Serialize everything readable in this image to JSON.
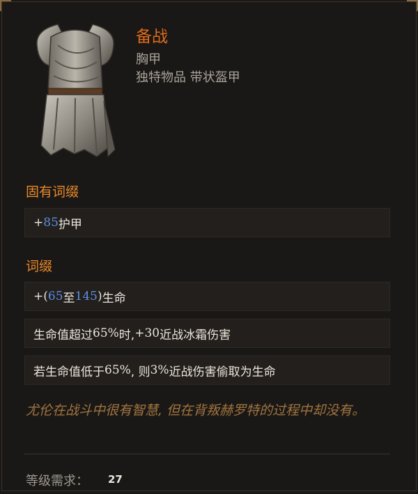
{
  "item": {
    "name": "备战",
    "slot": "胸甲",
    "type": "独特物品 带状盔甲",
    "image_icon": "chest-armor-icon"
  },
  "implicit": {
    "title": "固有词缀",
    "lines": [
      {
        "prefix": "+",
        "num1": "85",
        "text": " 护甲"
      }
    ]
  },
  "affixes": {
    "title": "词缀",
    "lines": [
      {
        "prefix": "+(",
        "num1": "65",
        "mid": " 至 ",
        "num2": "145",
        "suffix": ")",
        "text": " 生命"
      },
      {
        "text_a": "生命值超过 ",
        "value_a": "65%",
        "text_b": " 时, ",
        "value_b": "+30",
        "text_c": " 近战冰霜伤害"
      },
      {
        "text_a": "若生命值低于 ",
        "value_a": "65%",
        "text_b": ", 则 ",
        "value_b": "3%",
        "text_c": " 近战伤害偷取为生命"
      }
    ]
  },
  "flavor": "尤伦在战斗中很有智慧, 但在背叛赫罗特的过程中却没有。",
  "requirement": {
    "label": "等级需求：",
    "value": "27"
  },
  "colors": {
    "name": "#e06a1a",
    "section": "#e8892a",
    "number": "#5d8fe3",
    "flavor": "#a0753f"
  }
}
